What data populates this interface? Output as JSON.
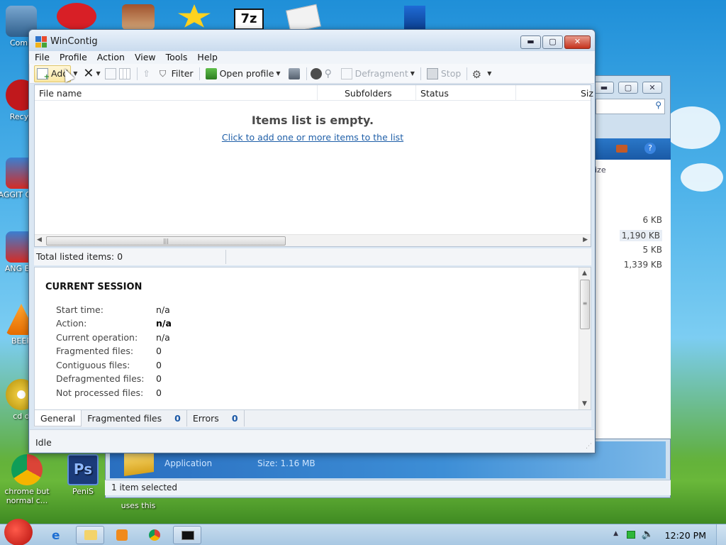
{
  "desktop": {
    "icons": [
      {
        "label": "Comp"
      },
      {
        "label": "Recyc"
      },
      {
        "label": "AGGIT CHIC"
      },
      {
        "label": "ANG BIR"
      },
      {
        "label": "BEEP"
      },
      {
        "label": "cd d"
      },
      {
        "label": "chrome but normal c..."
      },
      {
        "label": "PeniS"
      },
      {
        "label": "uses this"
      }
    ]
  },
  "bg_window": {
    "col_label": "ize",
    "sizes": [
      "6 KB",
      "1,190 KB",
      "5 KB",
      "1,339 KB"
    ],
    "details": {
      "type": "Application",
      "size": "Size: 1.16 MB"
    },
    "status": "1 item selected"
  },
  "window": {
    "title": "WinContig",
    "menu": [
      "File",
      "Profile",
      "Action",
      "View",
      "Tools",
      "Help"
    ],
    "toolbar": {
      "add": "Add",
      "filter": "Filter",
      "open_profile": "Open profile",
      "defragment": "Defragment",
      "stop": "Stop"
    },
    "list": {
      "columns": [
        "File name",
        "Subfolders",
        "Status",
        "Siz"
      ],
      "empty_title": "Items list is empty.",
      "empty_link": "Click to add one or more items to the list"
    },
    "total_listed": "Total listed items: 0",
    "session": {
      "heading": "CURRENT SESSION",
      "rows": [
        {
          "label": "Start time:",
          "value": "n/a"
        },
        {
          "label": "Action:",
          "value": "n/a"
        },
        {
          "label": "Current operation:",
          "value": "n/a"
        },
        {
          "label": "Fragmented files:",
          "value": "0"
        },
        {
          "label": "Contiguous files:",
          "value": "0"
        },
        {
          "label": "Defragmented files:",
          "value": "0"
        },
        {
          "label": "Not processed files:",
          "value": "0"
        }
      ]
    },
    "tabs": [
      {
        "label": "General"
      },
      {
        "label": "Fragmented files",
        "count": "0"
      },
      {
        "label": "Errors",
        "count": "0"
      }
    ],
    "status": "Idle"
  },
  "taskbar": {
    "clock": "12:20 PM"
  },
  "colors": {
    "link": "#1f5fa8",
    "count": "#1a57a5",
    "close": "#c5321c"
  }
}
